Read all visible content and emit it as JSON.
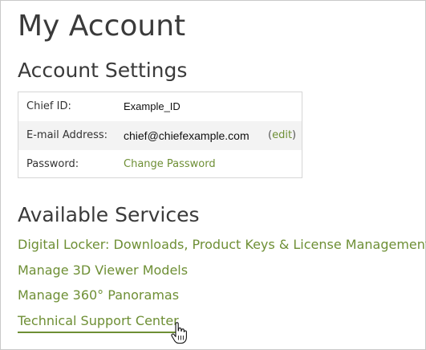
{
  "page": {
    "title": "My Account"
  },
  "account_settings": {
    "heading": "Account Settings",
    "rows": [
      {
        "label": "Chief ID:",
        "value": "Example_ID"
      },
      {
        "label": "E-mail Address:",
        "value": "chief@chiefexample.com",
        "edit_open": "(",
        "edit_label": "edit",
        "edit_close": ")"
      },
      {
        "label": "Password:",
        "value": "Change Password"
      }
    ]
  },
  "available_services": {
    "heading": "Available Services",
    "links": [
      "Digital Locker: Downloads, Product Keys & License Management",
      "Manage 3D Viewer Models",
      "Manage 360° Panoramas",
      "Technical Support Center"
    ]
  },
  "colors": {
    "link": "#6e8f35",
    "heading": "#3a3a3a",
    "row_alt_bg": "#f3f3f3",
    "border": "#d6d6d6"
  },
  "icons": {
    "cursor": "hand-pointer-icon"
  }
}
